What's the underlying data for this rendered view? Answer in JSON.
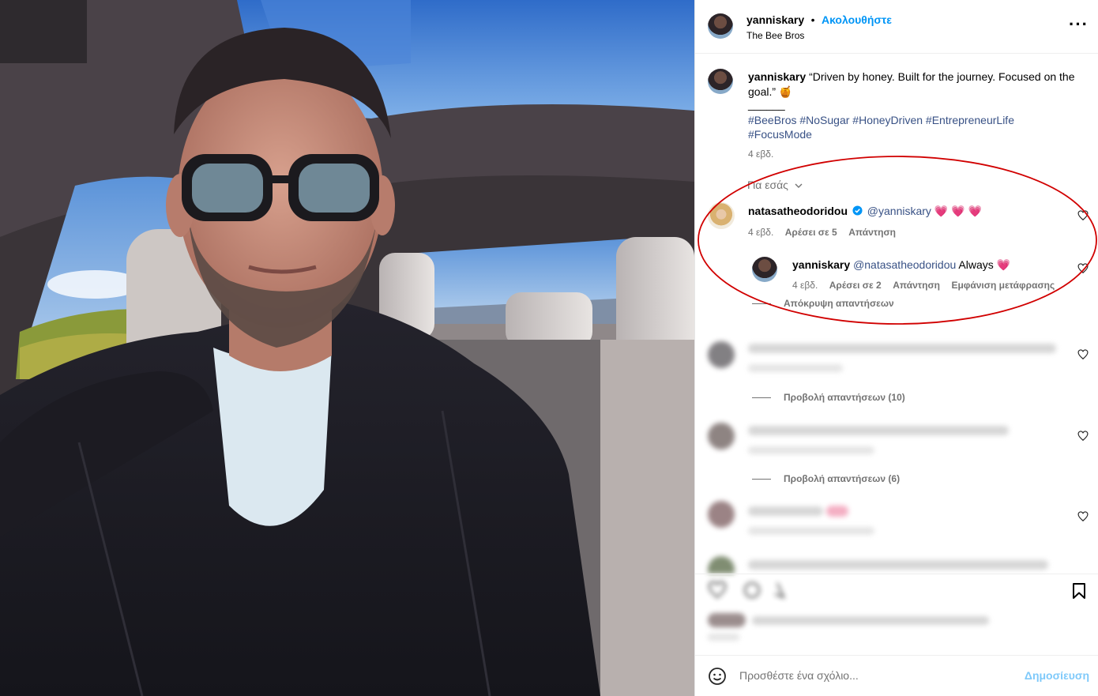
{
  "header": {
    "username": "yanniskary",
    "separator": "•",
    "follow_label": "Ακολουθήστε",
    "subtitle": "The Bee Bros",
    "more_icon": "more-horizontal-icon"
  },
  "caption": {
    "username": "yanniskary",
    "text": "“Driven by honey. Built for the journey. Focused on the goal.” 🍯",
    "separator_line": "______",
    "hashtags_line1": "#BeeBros #NoSugar #HoneyDriven #EntrepreneurLife",
    "hashtags_line2": "#FocusMode",
    "time": "4 εβδ."
  },
  "for_you": {
    "label": "Για εσάς"
  },
  "comments": [
    {
      "username": "natasatheodoridou",
      "verified": true,
      "mention": "@yanniskary",
      "text": "💗 💗 💗",
      "time": "4 εβδ.",
      "likes": "Αρέσει σε 5",
      "reply": "Απάντηση"
    }
  ],
  "reply": {
    "username": "yanniskary",
    "mention": "@natasatheodoridou",
    "text": "Always 💗",
    "time": "4 εβδ.",
    "likes": "Αρέσει σε 2",
    "reply": "Απάντηση",
    "translate": "Εμφάνιση μετάφρασης",
    "hide_replies": "Απόκρυψη απαντήσεων"
  },
  "blurred_comments": [
    {
      "view_replies": "Προβολή απαντήσεων (10)"
    },
    {
      "view_replies": "Προβολή απαντήσεων (6)"
    }
  ],
  "composer": {
    "placeholder": "Προσθέστε ένα σχόλιο...",
    "post_label": "Δημοσίευση",
    "emoji_icon": "emoji-icon"
  },
  "colors": {
    "accent": "#0095f6",
    "link": "#385185",
    "heart": "#ed2f6a",
    "ellipse": "#d10000"
  }
}
